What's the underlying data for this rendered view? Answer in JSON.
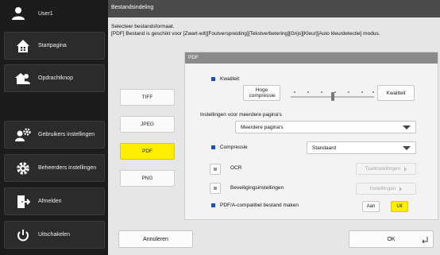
{
  "sidebar": {
    "user": "User1",
    "items": [
      {
        "label": "Startpagina",
        "icon": "home-icon"
      },
      {
        "label": "Opdrachtknop",
        "icon": "job-button-icon"
      },
      {
        "label": "Gebruikers instellingen",
        "icon": "user-settings-icon"
      },
      {
        "label": "Beheerders instellingen",
        "icon": "admin-settings-icon"
      },
      {
        "label": "Afmelden",
        "icon": "logout-icon"
      },
      {
        "label": "Uitschakelen",
        "icon": "power-icon"
      }
    ]
  },
  "main": {
    "title": "Bestandsindeling",
    "instruction_line1": "Selecteer bestandsformaat.",
    "instruction_line2": "[PDF] Bestand is geschikt voor [Zwart-wit][Foutverspreiding][Tekstverbetering][Grijs][Kleur][Auto kleurdetectie] modus.",
    "formats": [
      "TIFF",
      "JPEG",
      "PDF",
      "PNG"
    ],
    "selected_format": "PDF"
  },
  "pdf": {
    "header": "PDF",
    "quality_label": "Kwaliteit",
    "quality_low": "Hoge compressie",
    "quality_high": "Kwaliteit",
    "quality_level_fraction": 0.5,
    "multipage_label": "Instellingen voor meerdere pagina's",
    "multipage_value": "Meerdere pagina's",
    "compression_label": "Compressie",
    "compression_value": "Standaard",
    "ocr_label": "OCR",
    "ocr_button": "Taalinstellingen",
    "security_label": "Beveiligingsinstellingen",
    "security_button": "Instellingen",
    "pdfa_label": "PDF/A-compatibel bestand maken",
    "pdfa_on": "Aan",
    "pdfa_off": "Uit",
    "pdfa_value": "Uit"
  },
  "footer": {
    "cancel": "Annuleren",
    "ok": "OK"
  },
  "colors": {
    "accent": "#ffee00",
    "bullet": "#1f4fb3",
    "sidebar_bg": "#1c1c1c",
    "titlebar_bg": "#4b4b4b"
  }
}
